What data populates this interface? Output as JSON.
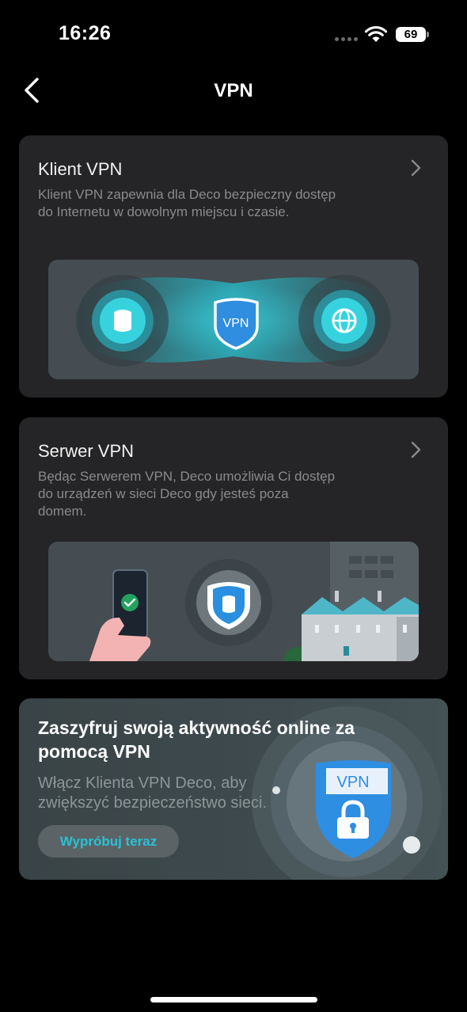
{
  "status": {
    "time": "16:26",
    "battery": "69"
  },
  "header": {
    "title": "VPN"
  },
  "vpn_client": {
    "title": "Klient VPN",
    "description": "Klient VPN zapewnia dla Deco bezpieczny dostęp do Internetu w dowolnym miejscu i czasie.",
    "shield_label": "VPN"
  },
  "vpn_server": {
    "title": "Serwer VPN",
    "description": "Będąc Serwerem VPN, Deco umożliwia Ci dostęp do urządzeń w sieci Deco gdy jesteś poza domem."
  },
  "promo": {
    "title": "Zaszyfruj swoją aktywność online za pomocą VPN",
    "description": "Włącz Klienta VPN Deco, aby zwiększyć bezpieczeństwo sieci.",
    "button_label": "Wypróbuj teraz",
    "shield_label": "VPN"
  },
  "colors": {
    "accent": "#29c2d8",
    "card_bg": "#252527",
    "background": "#000000"
  }
}
